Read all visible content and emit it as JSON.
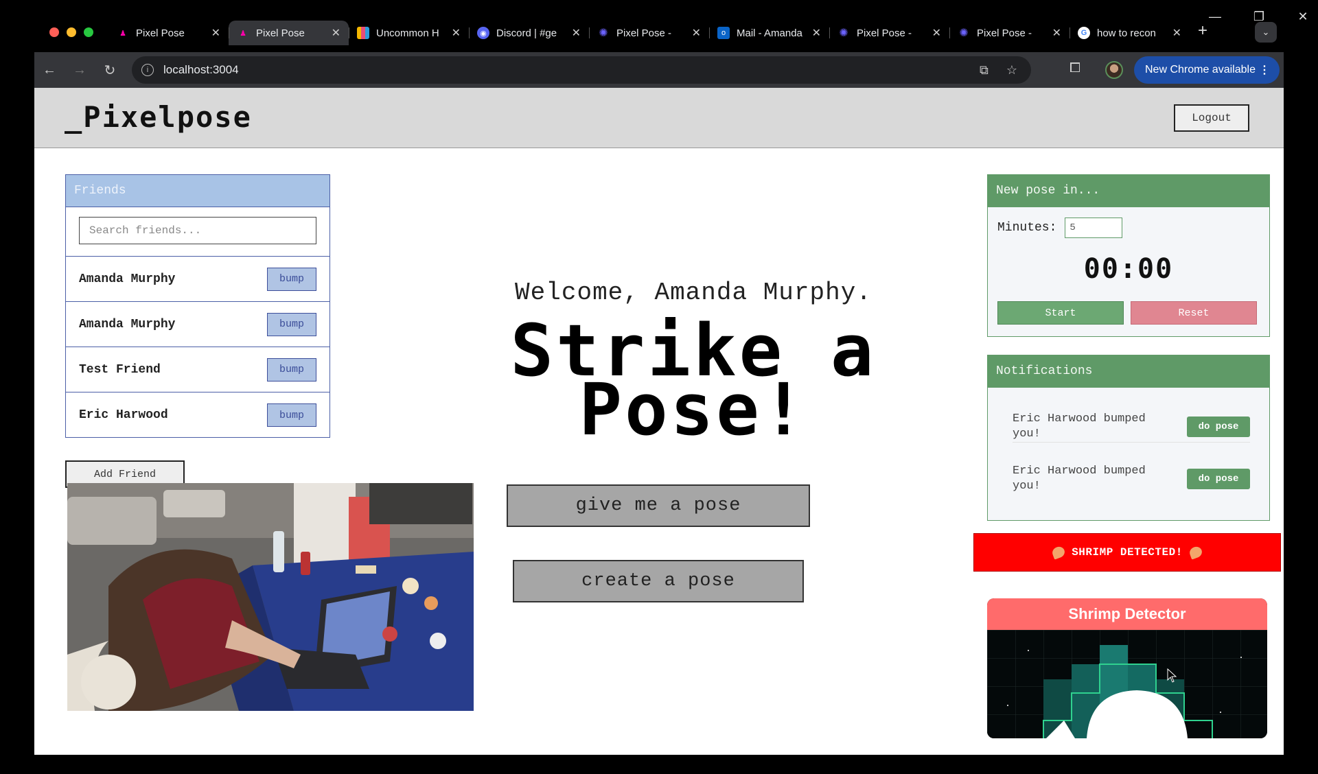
{
  "browser": {
    "tabs": [
      {
        "title": "Pixel Pose",
        "active": false,
        "icon": "pose-figure-icon"
      },
      {
        "title": "Pixel Pose",
        "active": true,
        "icon": "pose-figure-icon"
      },
      {
        "title": "Uncommon H",
        "active": false,
        "icon": "uncommon-icon"
      },
      {
        "title": "Discord | #ge",
        "active": false,
        "icon": "discord-icon"
      },
      {
        "title": "Pixel Pose - ",
        "active": false,
        "icon": "gear-flower-icon"
      },
      {
        "title": "Mail - Amanda",
        "active": false,
        "icon": "outlook-icon"
      },
      {
        "title": "Pixel Pose - ",
        "active": false,
        "icon": "gear-flower-icon"
      },
      {
        "title": "Pixel Pose - ",
        "active": false,
        "icon": "gear-flower-icon"
      },
      {
        "title": "how to recon",
        "active": false,
        "icon": "google-icon"
      }
    ],
    "url": "localhost:3004",
    "update_button": "New Chrome available"
  },
  "header": {
    "logo": "_Pixelpose",
    "logout_label": "Logout"
  },
  "friends": {
    "title": "Friends",
    "search_placeholder": "Search friends...",
    "list": [
      {
        "name": "Amanda Murphy",
        "action": "bump"
      },
      {
        "name": "Amanda Murphy",
        "action": "bump"
      },
      {
        "name": "Test Friend",
        "action": "bump"
      },
      {
        "name": "Eric Harwood",
        "action": "bump"
      }
    ],
    "add_label": "Add Friend"
  },
  "main": {
    "welcome": "Welcome, Amanda Murphy.",
    "hero_line1": "Strike a",
    "hero_line2": "Pose!",
    "give_pose_label": "give me a pose",
    "create_pose_label": "create a pose"
  },
  "timer": {
    "title": "New pose in...",
    "minutes_label": "Minutes:",
    "minutes_value": "5",
    "display": "00:00",
    "start_label": "Start",
    "reset_label": "Reset"
  },
  "notifications": {
    "title": "Notifications",
    "items": [
      {
        "text": "Eric Harwood bumped you!",
        "action": "do pose"
      },
      {
        "text": "Eric Harwood bumped you!",
        "action": "do pose"
      }
    ]
  },
  "shrimp": {
    "banner": "SHRIMP DETECTED!",
    "detector_title": "Shrimp Detector"
  },
  "colors": {
    "friends_accent": "#a8c3e6",
    "panel_green": "#5f9a67",
    "banner_red": "#ff0000",
    "detector_header": "#ff6b6b"
  }
}
